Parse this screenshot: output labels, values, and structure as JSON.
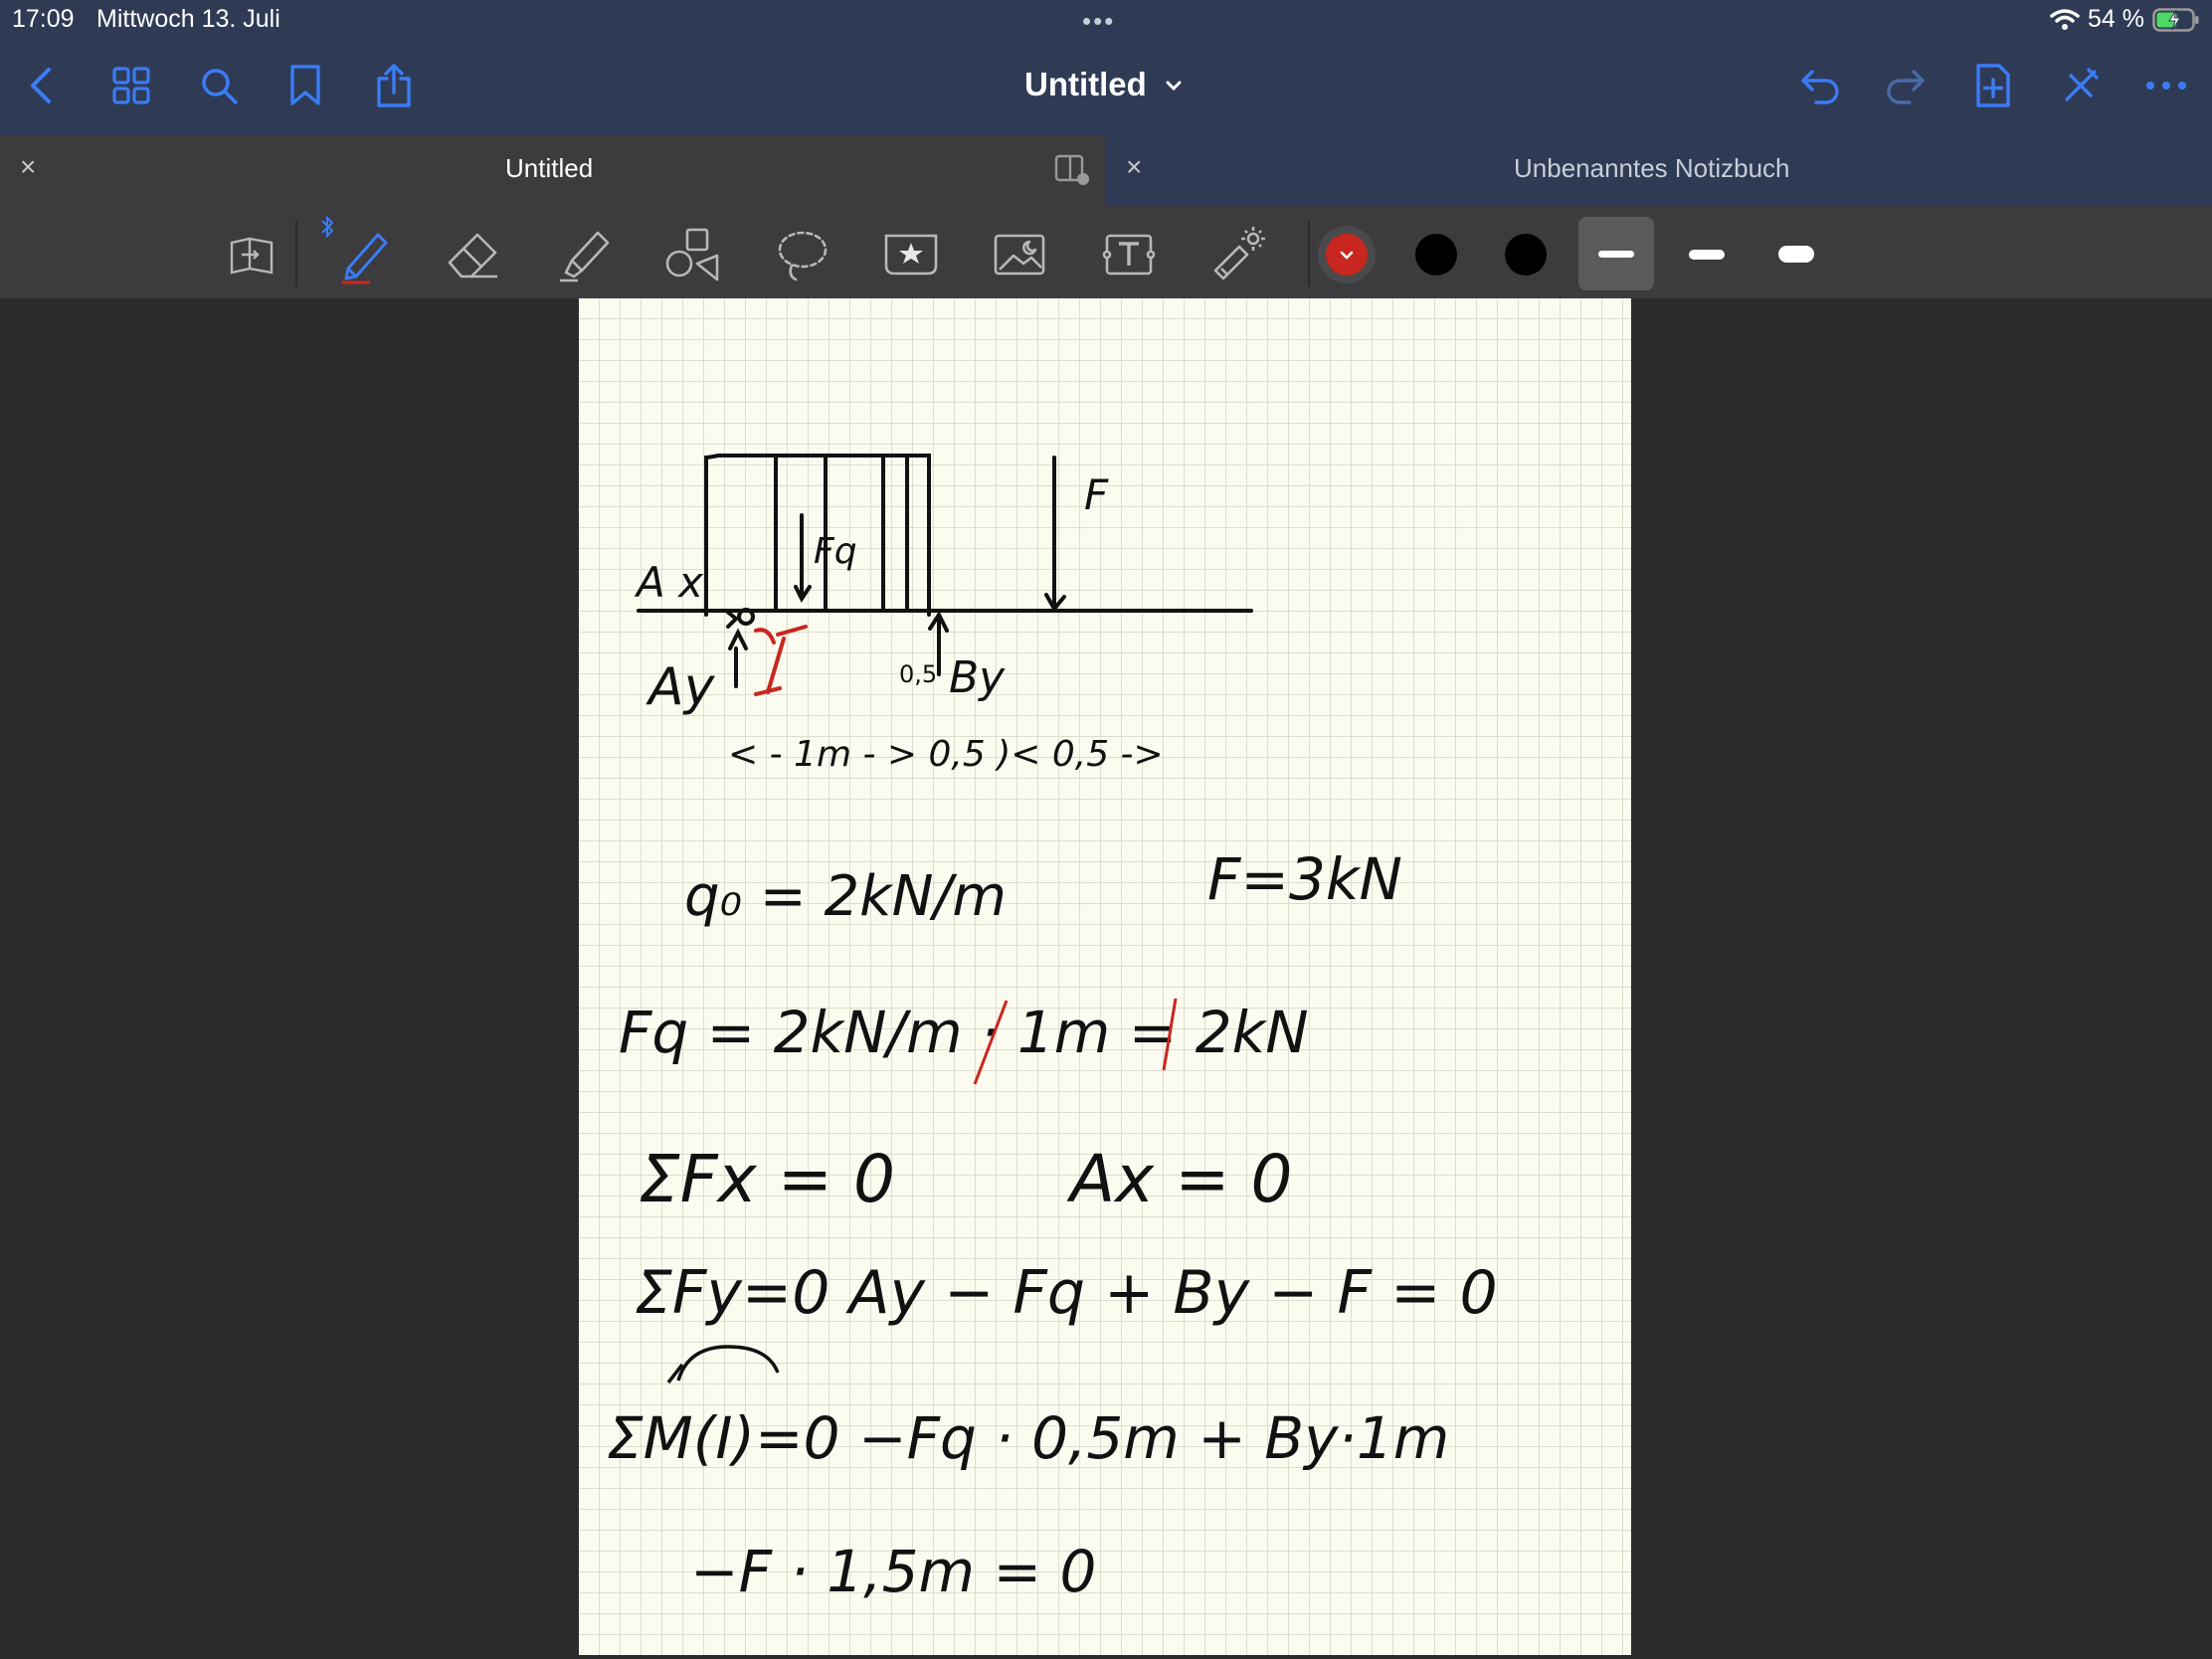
{
  "status": {
    "time": "17:09",
    "date": "Mittwoch 13. Juli",
    "battery": "54 %"
  },
  "nav": {
    "title": "Untitled"
  },
  "tabs": [
    {
      "title": "Untitled"
    },
    {
      "title": "Unbenanntes Notizbuch"
    }
  ],
  "toolbar": {
    "colors": [
      "#c8261e",
      "#000000",
      "#000000"
    ],
    "selected_color": "#c8261e",
    "stroke_sizes": [
      "thin",
      "medium",
      "thick"
    ],
    "selected_stroke": "thin"
  },
  "accent": "#3b7bf5",
  "note": {
    "labels": {
      "ax": "A x",
      "ay": "Ay",
      "fq": "Fq",
      "f": "F",
      "by": "By",
      "point_mid": "0,5",
      "support_mark": "I"
    },
    "dimension_row": "< - 1m - >   0,5 )< 0,5 ->",
    "lines": [
      "q₀ = 2kN/m",
      "F=3kN",
      "Fq = 2kN/m · 1m = 2kN",
      "ΣFx = 0",
      "Ax = 0",
      "ΣFy=0  Ay − Fq + By − F = 0",
      "ΣM(I)=0  −Fq · 0,5m + By·1m",
      "−F · 1,5m = 0"
    ]
  }
}
